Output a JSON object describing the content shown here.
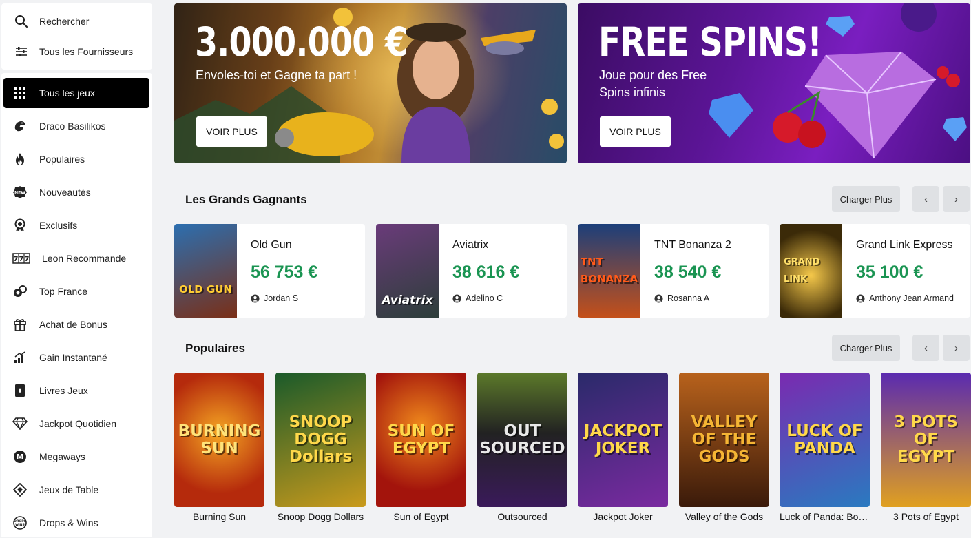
{
  "sidebar": {
    "search_label": "Rechercher",
    "providers_label": "Tous les Fournisseurs",
    "menu": [
      {
        "label": "Tous les jeux",
        "icon": "grid-icon",
        "active": true
      },
      {
        "label": "Draco Basilikos",
        "icon": "dragon-icon"
      },
      {
        "label": "Populaires",
        "icon": "flame-icon"
      },
      {
        "label": "Nouveautés",
        "icon": "new-badge-icon"
      },
      {
        "label": "Exclusifs",
        "icon": "medal-icon"
      },
      {
        "label": "Leon Recommande",
        "icon": "slot-777-icon"
      },
      {
        "label": "Top France",
        "icon": "coins-icon"
      },
      {
        "label": "Achat de Bonus",
        "icon": "gift-icon"
      },
      {
        "label": "Gain Instantané",
        "icon": "bar-chart-icon"
      },
      {
        "label": "Livres Jeux",
        "icon": "book-icon"
      },
      {
        "label": "Jackpot Quotidien",
        "icon": "diamond-icon"
      },
      {
        "label": "Megaways",
        "icon": "megaways-icon"
      },
      {
        "label": "Jeux de Table",
        "icon": "cards-icon"
      },
      {
        "label": "Drops & Wins",
        "icon": "drops-wins-icon"
      }
    ]
  },
  "banners": [
    {
      "title": "3.000.000 €",
      "subtitle": "Envoles-toi et Gagne ta part !",
      "button": "VOIR PLUS"
    },
    {
      "title": "FREE SPINS!",
      "subtitle": "Joue pour des Free Spins infinis",
      "button": "VOIR PLUS"
    }
  ],
  "winners_section": {
    "title": "Les Grands Gagnants",
    "load_more": "Charger Plus",
    "items": [
      {
        "game": "Old Gun",
        "amount": "56 753 €",
        "user": "Jordan S",
        "logo": "OLD GUN",
        "bg": "#7a2f17",
        "bg2": "#2c6fb0"
      },
      {
        "game": "Aviatrix",
        "amount": "38 616 €",
        "user": "Adelino C",
        "logo": "Aviatrix",
        "bg": "#2d3e3a",
        "bg2": "#6a3b7a"
      },
      {
        "game": "TNT Bonanza 2",
        "amount": "38 540 €",
        "user": "Rosanna A",
        "logo": "TNT BONANZA",
        "bg": "#1c3f7a",
        "bg2": "#c4501a"
      },
      {
        "game": "Grand Link Express",
        "amount": "35 100 €",
        "user": "Anthony Jean Armand",
        "logo": "GRAND LINK",
        "bg": "#3b2a08",
        "bg2": "#c99a1c"
      }
    ]
  },
  "popular_section": {
    "title": "Populaires",
    "load_more": "Charger Plus",
    "games": [
      {
        "name": "Burning Sun",
        "logo": "BURNING SUN",
        "bg": "#b52a0c",
        "bg2": "#f5a623",
        "fg": "#ffe37a"
      },
      {
        "name": "Snoop Dogg Dollars",
        "logo": "SNOOP DOGG Dollars",
        "bg": "#1a5a2a",
        "bg2": "#c99a1c",
        "fg": "#ffd84a"
      },
      {
        "name": "Sun of Egypt",
        "logo": "SUN OF EGYPT",
        "bg": "#a3140c",
        "bg2": "#f08a1c",
        "fg": "#ffd84a"
      },
      {
        "name": "Outsourced",
        "logo": "OUT SOURCED",
        "bg": "#222222",
        "bg2": "#5c7a2a",
        "fg": "#e9e9e9"
      },
      {
        "name": "Jackpot Joker",
        "logo": "JACKPOT JOKER",
        "bg": "#2a2a6a",
        "bg2": "#7a2aa0",
        "fg": "#ffd84a"
      },
      {
        "name": "Valley of the Gods",
        "logo": "VALLEY OF THE GODS",
        "bg": "#3a1a0a",
        "bg2": "#b8621c",
        "fg": "#f5b534"
      },
      {
        "name": "Luck of Panda: Bonus Combo",
        "logo": "LUCK OF PANDA",
        "bg": "#7a2ab0",
        "bg2": "#2a7ac0",
        "fg": "#ffd84a"
      },
      {
        "name": "3 Pots of Egypt",
        "logo": "3 POTS OF EGYPT",
        "bg": "#5a2ab0",
        "bg2": "#e0a020",
        "fg": "#ffd84a"
      }
    ]
  }
}
